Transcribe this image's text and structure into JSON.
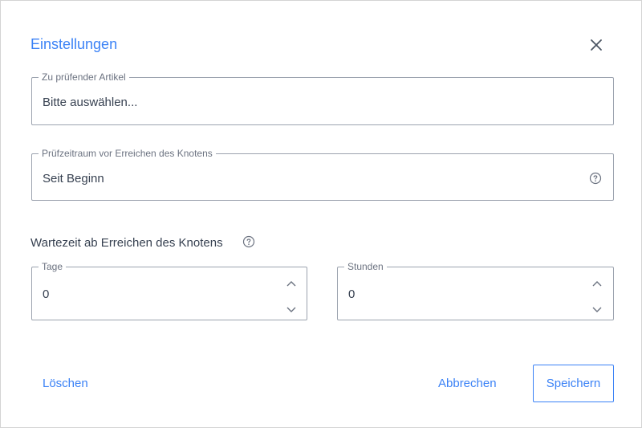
{
  "dialog": {
    "title": "Einstellungen",
    "close_icon": "close-icon"
  },
  "article_field": {
    "legend": "Zu prüfender Artikel",
    "value": "Bitte auswählen..."
  },
  "period_field": {
    "legend": "Prüfzeitraum vor Erreichen des Knotens",
    "value": "Seit Beginn",
    "help_icon": "help-icon"
  },
  "waiting": {
    "label": "Wartezeit ab Erreichen des Knotens",
    "help_icon": "help-icon",
    "days": {
      "legend": "Tage",
      "value": "0"
    },
    "hours": {
      "legend": "Stunden",
      "value": "0"
    }
  },
  "footer": {
    "delete_label": "Löschen",
    "cancel_label": "Abbrechen",
    "save_label": "Speichern"
  },
  "colors": {
    "accent": "#3b82f6",
    "border": "#9ca3af",
    "text": "#374151"
  }
}
